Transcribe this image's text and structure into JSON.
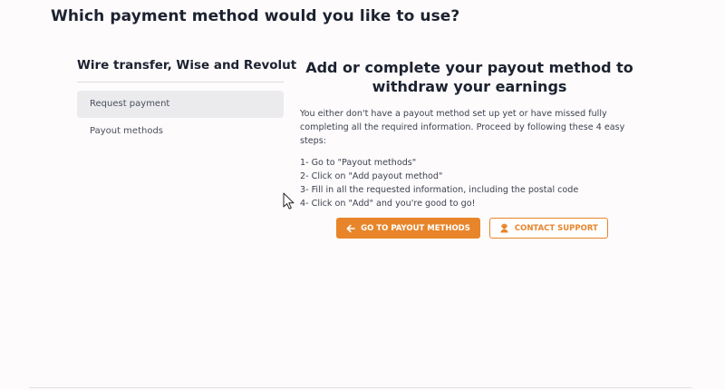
{
  "page": {
    "heading": "Which payment method would you like to use?"
  },
  "sidebar": {
    "title": "Wire transfer, Wise and Revolut",
    "items": [
      {
        "label": "Request payment",
        "active": true
      },
      {
        "label": "Payout methods",
        "active": false
      }
    ]
  },
  "main": {
    "title_line1": "Add or complete your payout method to",
    "title_line2": "withdraw your earnings",
    "description": "You either don't have a payout method set up yet or have missed fully completing all the required information. Proceed by following these 4 easy steps:",
    "steps": [
      "1- Go to \"Payout methods\"",
      "2- Click on \"Add payout method\"",
      "3- Fill in all the requested information, including the postal code",
      "4- Click on \"Add\" and you're good to go!"
    ]
  },
  "actions": {
    "primary_label": "GO TO PAYOUT METHODS",
    "primary_icon": "arrow-left-icon",
    "secondary_label": "CONTACT SUPPORT",
    "secondary_icon": "support-agent-icon"
  },
  "colors": {
    "accent": "#e8852a",
    "text_dark": "#1c2230",
    "active_item_bg": "#ebebee"
  }
}
